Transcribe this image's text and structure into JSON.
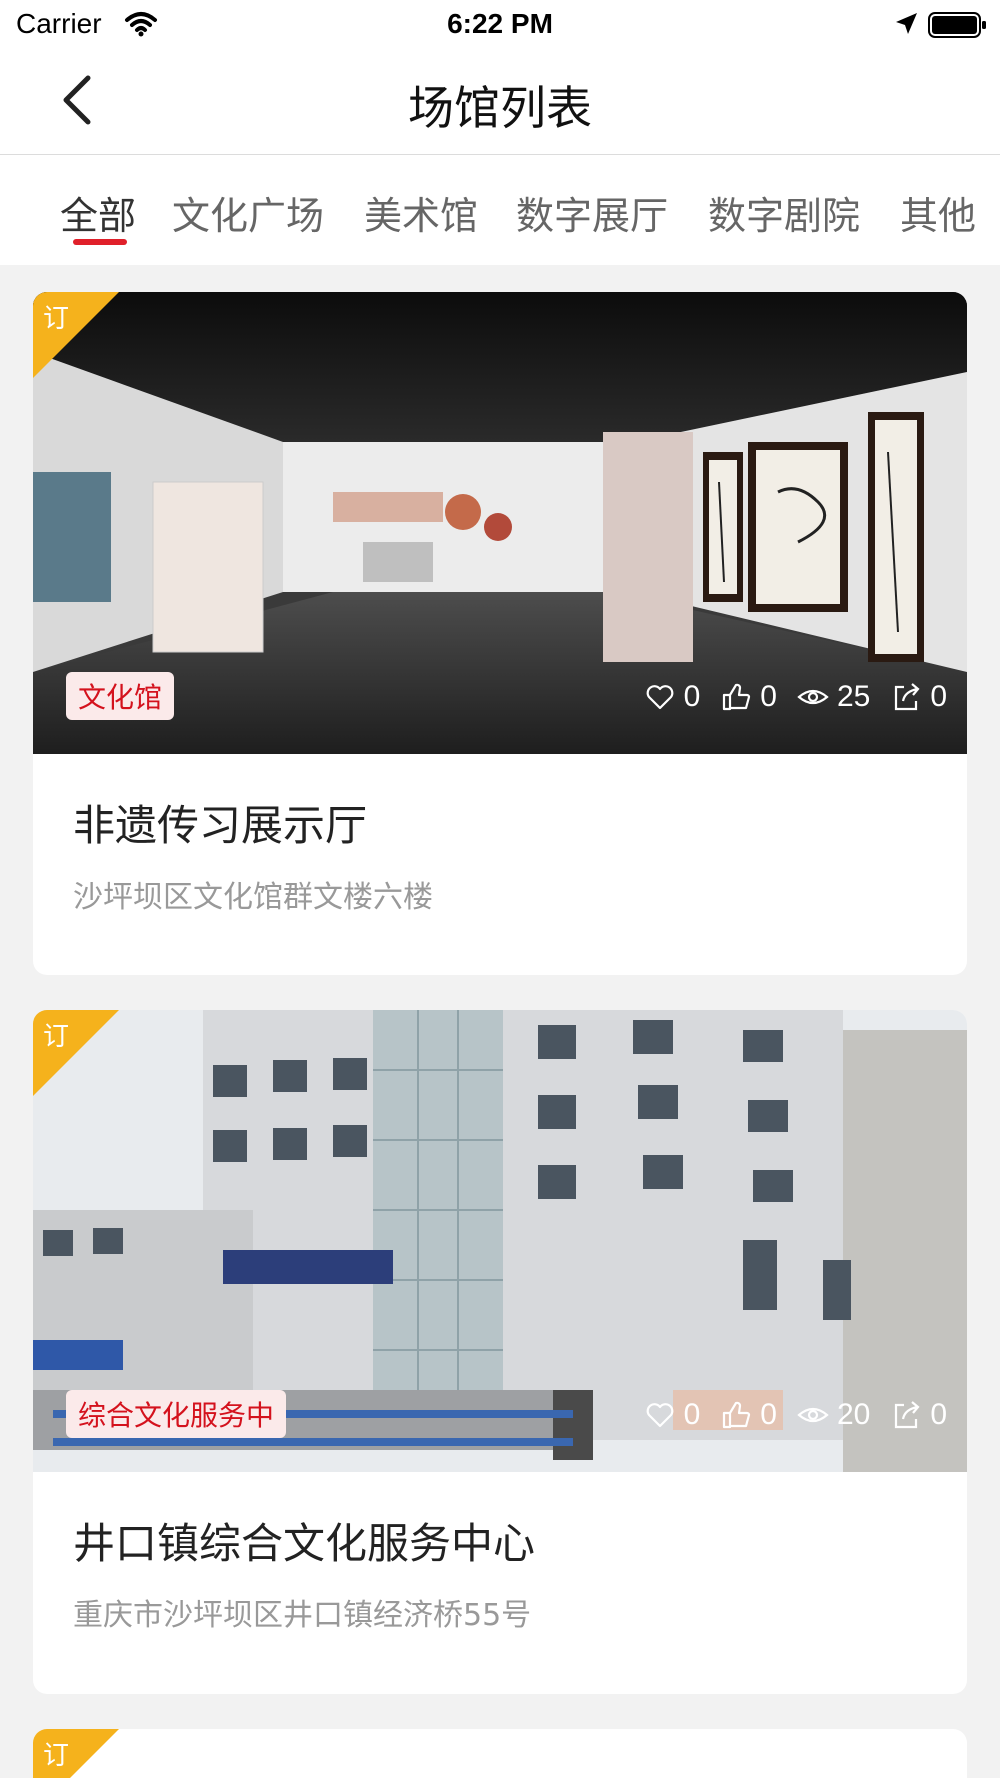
{
  "status_bar": {
    "carrier": "Carrier",
    "time": "6:22 PM"
  },
  "nav": {
    "title": "场馆列表"
  },
  "tabs": [
    {
      "label": "全部",
      "active": true
    },
    {
      "label": "文化广场",
      "active": false
    },
    {
      "label": "美术馆",
      "active": false
    },
    {
      "label": "数字展厅",
      "active": false
    },
    {
      "label": "数字剧院",
      "active": false
    },
    {
      "label": "其他",
      "active": false
    }
  ],
  "colors": {
    "accent": "#e0202a",
    "ribbon": "#f5b21c"
  },
  "venues": [
    {
      "ribbon": "订",
      "category": "文化馆",
      "favorites": "0",
      "likes": "0",
      "views": "25",
      "shares": "0",
      "name": "非遗传习展示厅",
      "address": "沙坪坝区文化馆群文楼六楼"
    },
    {
      "ribbon": "订",
      "category": "综合文化服务中",
      "favorites": "0",
      "likes": "0",
      "views": "20",
      "shares": "0",
      "name": "井口镇综合文化服务中心",
      "address": "重庆市沙坪坝区井口镇经济桥55号"
    },
    {
      "ribbon": "订"
    }
  ]
}
